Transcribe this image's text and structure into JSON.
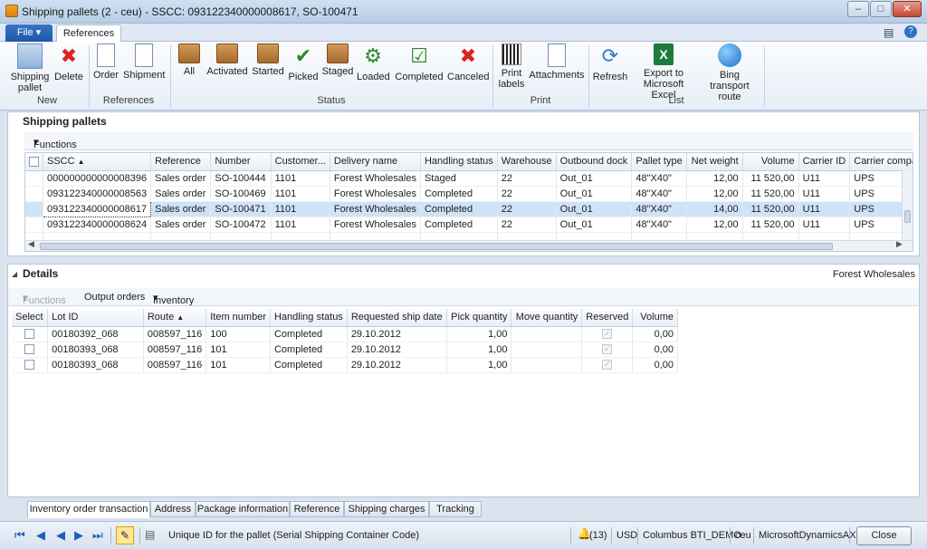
{
  "window": {
    "title": "Shipping pallets (2 - ceu) - SSCC: 093122340000008617, SO-100471"
  },
  "ribbon": {
    "file_tab": "File",
    "active_tab": "References",
    "groups": {
      "new": "New",
      "references": "References",
      "status": "Status",
      "print": "Print",
      "list": "List"
    },
    "buttons": {
      "shipping_pallet": "Shipping pallet",
      "delete": "Delete",
      "order": "Order",
      "shipment": "Shipment",
      "all": "All",
      "activated": "Activated",
      "started": "Started",
      "picked": "Picked",
      "staged": "Staged",
      "loaded": "Loaded",
      "completed": "Completed",
      "canceled": "Canceled",
      "print_labels": "Print labels",
      "attachments": "Attachments",
      "refresh": "Refresh",
      "export_excel": "Export to Microsoft Excel",
      "bing_route": "Bing transport route"
    }
  },
  "pallets": {
    "title": "Shipping pallets",
    "functions": "Functions",
    "columns": [
      "SSCC",
      "Reference",
      "Number",
      "Customer...",
      "Delivery name",
      "Handling status",
      "Warehouse",
      "Outbound dock",
      "Pallet type",
      "Net weight",
      "Volume",
      "Carrier ID",
      "Carrier compa"
    ],
    "rows": [
      [
        "000000000000008396",
        "Sales order",
        "SO-100444",
        "1101",
        "Forest Wholesales",
        "Staged",
        "22",
        "Out_01",
        "48\"X40\"",
        "12,00",
        "11 520,00",
        "U11",
        "UPS"
      ],
      [
        "093122340000008563",
        "Sales order",
        "SO-100469",
        "1101",
        "Forest Wholesales",
        "Completed",
        "22",
        "Out_01",
        "48\"X40\"",
        "12,00",
        "11 520,00",
        "U11",
        "UPS"
      ],
      [
        "093122340000008617",
        "Sales order",
        "SO-100471",
        "1101",
        "Forest Wholesales",
        "Completed",
        "22",
        "Out_01",
        "48\"X40\"",
        "14,00",
        "11 520,00",
        "U11",
        "UPS"
      ],
      [
        "093122340000008624",
        "Sales order",
        "SO-100472",
        "1101",
        "Forest Wholesales",
        "Completed",
        "22",
        "Out_01",
        "48\"X40\"",
        "12,00",
        "11 520,00",
        "U11",
        "UPS"
      ]
    ]
  },
  "details": {
    "title": "Details",
    "delivery_name": "Forest Wholesales",
    "functions": "Functions",
    "output_orders": "Output orders",
    "inventory": "Inventory",
    "columns": [
      "Select",
      "Lot ID",
      "Route",
      "Item number",
      "Handling status",
      "Requested ship date",
      "Pick quantity",
      "Move quantity",
      "Reserved",
      "Volume"
    ],
    "rows": [
      [
        "",
        "00180392_068",
        "008597_116",
        "100",
        "Completed",
        "29.10.2012",
        "1,00",
        "",
        "",
        "0,00"
      ],
      [
        "",
        "00180393_068",
        "008597_116",
        "101",
        "Completed",
        "29.10.2012",
        "1,00",
        "",
        "",
        "0,00"
      ],
      [
        "",
        "00180393_068",
        "008597_116",
        "101",
        "Completed",
        "29.10.2012",
        "1,00",
        "",
        "",
        "0,00"
      ]
    ]
  },
  "tabs": [
    "Inventory order transaction",
    "Address",
    "Package information",
    "Reference",
    "Shipping charges",
    "Tracking"
  ],
  "status": {
    "help": "Unique ID for the pallet (Serial Shipping Container Code)",
    "notifications": "(13)",
    "currency": "USD",
    "company": "Columbus BTI_DEMO",
    "partition": "ceu",
    "app": "MicrosoftDynamicsAX",
    "close": "Close"
  }
}
